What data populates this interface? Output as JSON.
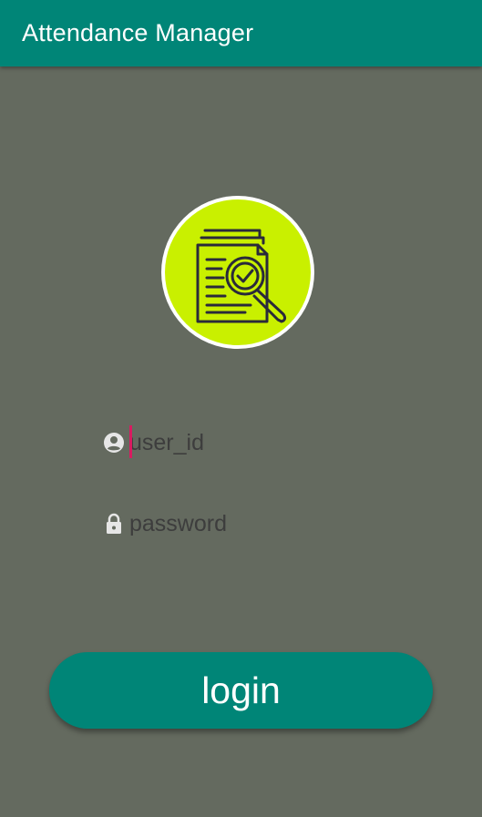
{
  "app": {
    "title": "Attendance Manager"
  },
  "logo": {
    "icon": "document-search-icon",
    "bg_color": "#c9f000",
    "ring_color": "#ffffff"
  },
  "form": {
    "user_id": {
      "placeholder": "user_id",
      "icon": "account-circle-icon"
    },
    "password": {
      "placeholder": "password",
      "icon": "lock-icon"
    },
    "login_label": "login"
  },
  "colors": {
    "primary": "#008577",
    "accent": "#d81b60",
    "background": "#646a5f"
  }
}
